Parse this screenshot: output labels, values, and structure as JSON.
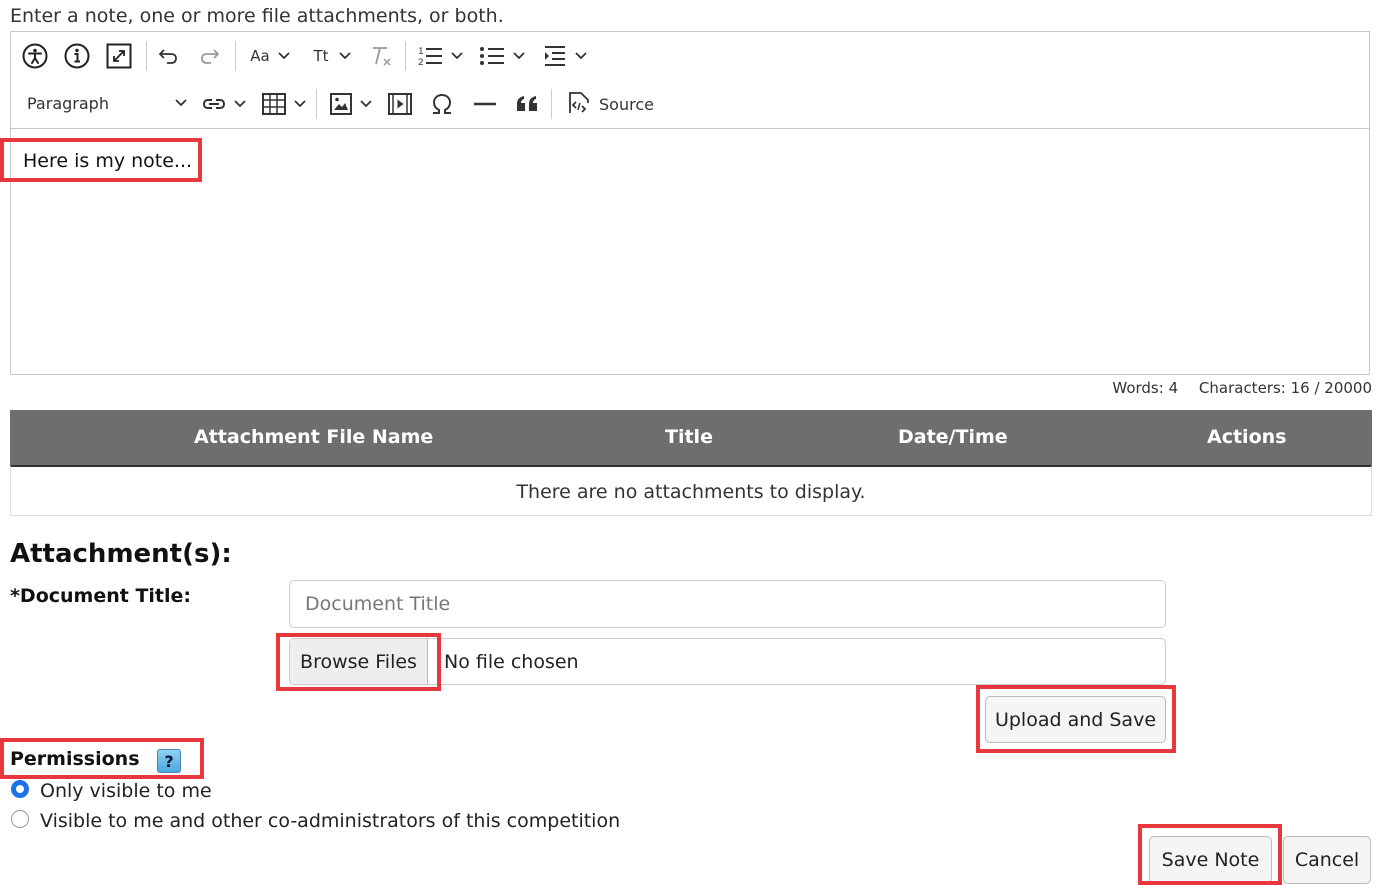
{
  "instructions": "Enter a note, one or more file attachments, or both.",
  "toolbar": {
    "icons": [
      "accessibility-icon",
      "info-icon",
      "fullscreen-icon",
      "undo-icon",
      "redo-icon",
      "font-family-icon",
      "font-size-icon",
      "remove-format-icon",
      "numbered-list-icon",
      "bulleted-list-icon",
      "indent-icon",
      "link-icon",
      "table-icon",
      "image-icon",
      "media-icon",
      "special-characters-icon",
      "horizontal-line-icon",
      "blockquote-icon",
      "source-icon"
    ],
    "font_family_label": "Aa",
    "font_size_label": "Tt",
    "paragraph_label": "Paragraph",
    "source_label": "Source"
  },
  "editor": {
    "content": "Here is my note..."
  },
  "counts": {
    "words": "Words: 4",
    "characters": "Characters: 16 / 20000"
  },
  "attachments_table": {
    "columns": [
      "Attachment File Name",
      "Title",
      "Date/Time",
      "Actions"
    ],
    "empty_message": "There are no attachments to display."
  },
  "attachments_section": {
    "heading": "Attachment(s):",
    "document_title_label": "*Document Title:",
    "document_title_placeholder": "Document Title",
    "browse_label": "Browse Files",
    "no_file_text": "No file chosen",
    "upload_label": "Upload and Save"
  },
  "permissions": {
    "label": "Permissions",
    "help_label": "?",
    "options": [
      {
        "label": "Only visible to me",
        "selected": true
      },
      {
        "label": "Visible to me and other co-administrators of this competition",
        "selected": false
      }
    ]
  },
  "actions": {
    "save_label": "Save Note",
    "cancel_label": "Cancel"
  },
  "colors": {
    "highlight": "#e8383d",
    "table_header": "#6e6e6e",
    "radio_selected": "#1a73e8"
  }
}
